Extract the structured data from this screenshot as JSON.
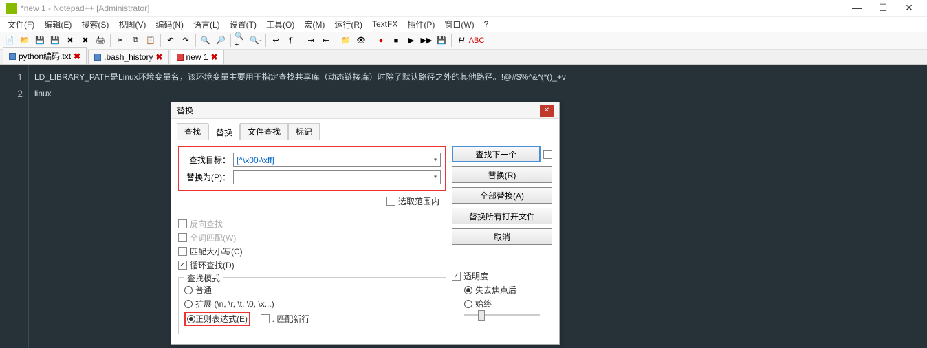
{
  "titlebar": {
    "text": "*new 1 - Notepad++ [Administrator]"
  },
  "menu": [
    "文件(F)",
    "编辑(E)",
    "搜索(S)",
    "视图(V)",
    "编码(N)",
    "语言(L)",
    "设置(T)",
    "工具(O)",
    "宏(M)",
    "运行(R)",
    "TextFX",
    "插件(P)",
    "窗口(W)",
    "?"
  ],
  "tabs": [
    {
      "label": "python编码.txt",
      "active": false
    },
    {
      "label": ".bash_history",
      "active": false
    },
    {
      "label": "new 1",
      "active": true
    }
  ],
  "editor": {
    "lines": [
      {
        "n": "1",
        "text": "LD_LIBRARY_PATH是Linux环境变量名，该环境变量主要用于指定查找共享库（动态链接库）时除了默认路径之外的其他路径。!@#$%^&*(*()_+v"
      },
      {
        "n": "",
        "text": "linux"
      },
      {
        "n": "2",
        "text": ""
      }
    ]
  },
  "dialog": {
    "title": "替换",
    "tabs": [
      "查找",
      "替换",
      "文件查找",
      "标记"
    ],
    "active_tab": "替换",
    "find_label": "查找目标：",
    "find_value": "[^\\x00-\\xff]",
    "replace_label": "替换为(P)：",
    "replace_value": "",
    "in_selection": "选取范围内",
    "btn_findnext": "查找下一个",
    "btn_replace": "替换(R)",
    "btn_replaceall": "全部替换(A)",
    "btn_infiles": "替换所有打开文件",
    "btn_cancel": "取消",
    "chk_backward": "反向查找",
    "chk_wholeword": "全词匹配(W)",
    "chk_case": "匹配大小写(C)",
    "chk_wrap": "循环查找(D)",
    "grp_mode": "查找模式",
    "rad_normal": "普通",
    "rad_extended": "扩展 (\\n, \\r, \\t, \\0, \\x...)",
    "rad_regex": "正则表达式(E)",
    "chk_newline": ". 匹配新行",
    "grp_trans": "透明度",
    "rad_onlose": "失去焦点后",
    "rad_always": "始终"
  }
}
